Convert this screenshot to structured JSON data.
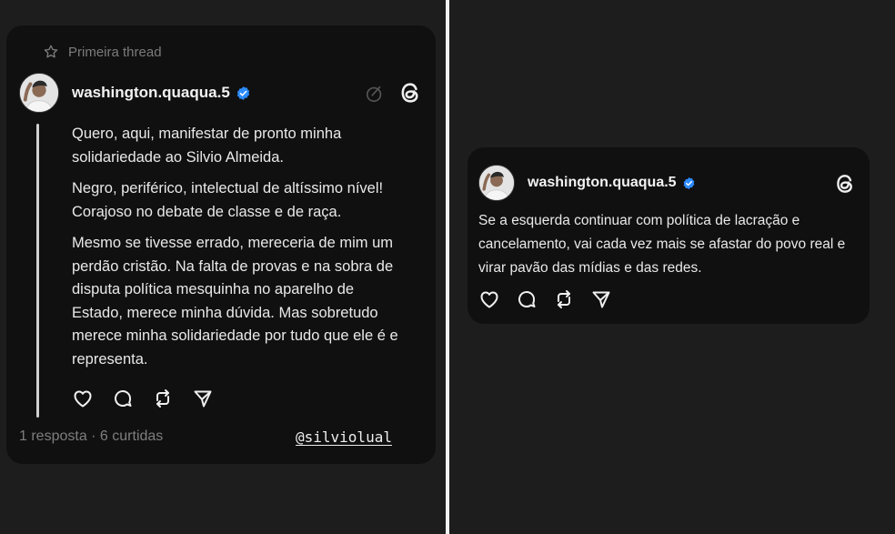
{
  "left_post": {
    "pinned_label": "Primeira thread",
    "username": "washington.quaqua.5",
    "paragraphs": [
      "Quero, aqui, manifestar de pronto minha solidariedade ao Silvio Almeida.",
      "Negro, periférico, intelectual de altíssimo nível! Corajoso no debate de classe e de raça.",
      "Mesmo se tivesse errado, mereceria de mim um perdão cristão. Na falta de provas e na sobra de disputa política mesquinha no aparelho de Estado, merece minha dúvida. Mas sobretudo merece minha solidariedade por tudo que ele é e representa."
    ],
    "stats": "1 resposta · 6 curtidas",
    "watermark_handle": "@silviolual"
  },
  "right_post": {
    "username": "washington.quaqua.5",
    "text": "Se a esquerda continuar com política de lacração e cancelamento, vai cada vez mais se afastar do povo real e virar pavão das mídias e das redes."
  },
  "icons": {
    "pin": "star-icon",
    "verified": "verified-badge-icon",
    "edit": "edit-circle-icon",
    "logo": "threads-logo-icon",
    "actions": [
      "heart-icon",
      "comment-icon",
      "repost-icon",
      "share-icon"
    ]
  },
  "colors": {
    "background": "#1d1d1d",
    "card": "#101010",
    "verified": "#2d8cff",
    "text": "#e9e9e9",
    "muted": "#7e7e7e"
  }
}
